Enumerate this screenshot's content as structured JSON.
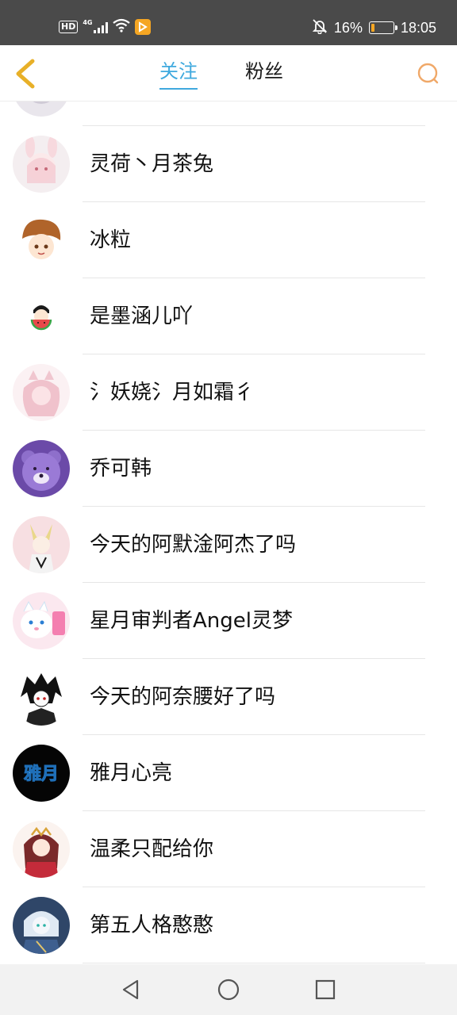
{
  "status_bar": {
    "hd": "HD",
    "network": "4G",
    "battery_percent": "16%",
    "battery_level": 0.16,
    "time": "18:05",
    "icons": [
      "signal-icon",
      "wifi-icon",
      "app-notification-icon",
      "bell-off-icon",
      "battery-icon"
    ]
  },
  "header": {
    "tabs": [
      {
        "label": "关注",
        "active": true
      },
      {
        "label": "粉丝",
        "active": false
      }
    ],
    "accent_color": "#3fa9de",
    "back_icon_color": "#e8b028",
    "search_icon_color": "#f0a868"
  },
  "follow_list": [
    {
      "name": ""
    },
    {
      "name": "灵荷丶月茶兔"
    },
    {
      "name": "冰粒"
    },
    {
      "name": "是墨涵儿吖"
    },
    {
      "name": "氵妖娆氵月如霜彳"
    },
    {
      "name": "乔可韩"
    },
    {
      "name": "今天的阿默淦阿杰了吗"
    },
    {
      "name": "星月审判者Angel灵梦"
    },
    {
      "name": "今天的阿奈腰好了吗"
    },
    {
      "name": "雅月心亮"
    },
    {
      "name": "温柔只配给你"
    },
    {
      "name": "第五人格憨憨"
    }
  ],
  "avatar_texts": {
    "yayue": "雅月"
  }
}
